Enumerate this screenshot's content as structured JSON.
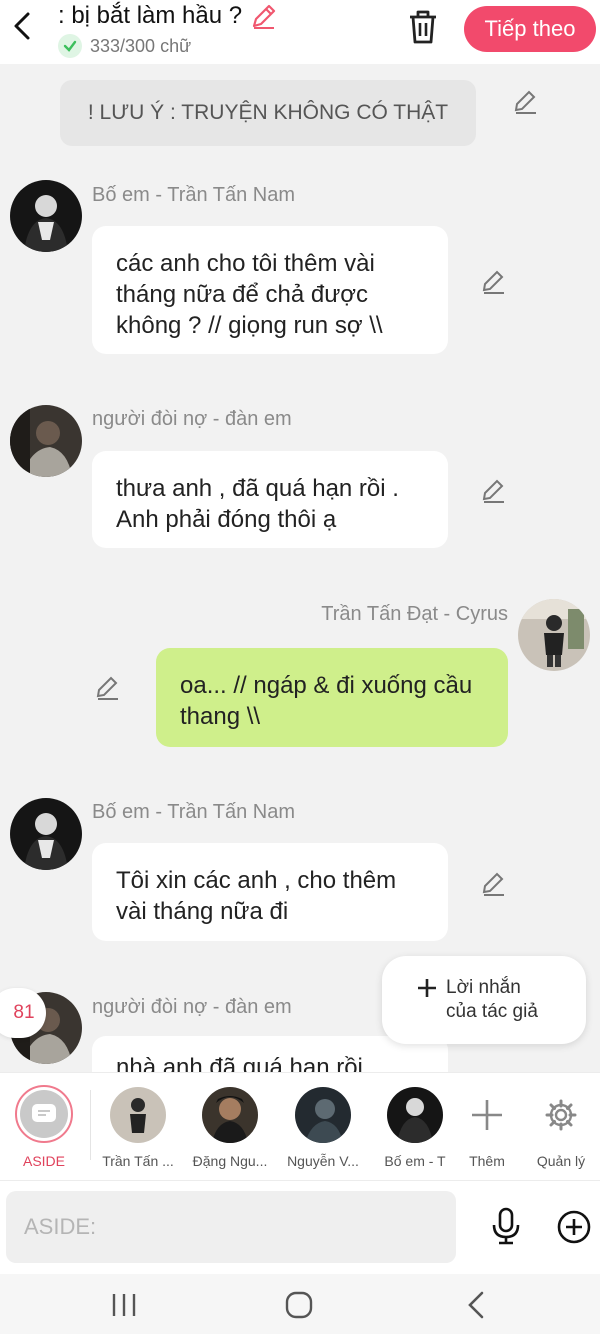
{
  "header": {
    "title": ": bị bắt làm hầu ?",
    "word_count": "333/300 chữ",
    "next_label": "Tiếp theo"
  },
  "colors": {
    "accent": "#f24a6c",
    "user_bubble": "#cfef8b",
    "check": "#3cbf5c"
  },
  "chat": {
    "note": "! LƯU Ý : TRUYỆN KHÔNG CÓ THẬT",
    "messages": [
      {
        "sender": "Bố em - Trần Tấn Nam",
        "text": "các anh cho tôi thêm vài tháng nữa để chả được không ? // giọng run sợ \\\\"
      },
      {
        "sender": "người đòi nợ - đàn em",
        "text": "thưa anh , đã quá hạn rồi . Anh phải đóng thôi ạ"
      },
      {
        "sender": "Trần Tấn Đạt - Cyrus",
        "text": "oa... // ngáp & đi xuống cầu thang \\\\"
      },
      {
        "sender": "Bố em - Trần Tấn Nam",
        "text": "Tôi xin các anh , cho thêm vài tháng nữa đi"
      },
      {
        "sender": "người đòi nợ - đàn em",
        "text": "nhà anh đã quá hạn rồi"
      }
    ],
    "count_badge": "81",
    "author_note_label": "Lời nhắn\ncủa tác giả"
  },
  "characters": {
    "aside": "ASIDE",
    "items": [
      "Trần Tấn ...",
      "Đặng Ngu...",
      "Nguyễn V...",
      "Bố em - T"
    ],
    "add_label": "Thêm",
    "manage_label": "Quản lý"
  },
  "input": {
    "placeholder": "ASIDE:"
  }
}
